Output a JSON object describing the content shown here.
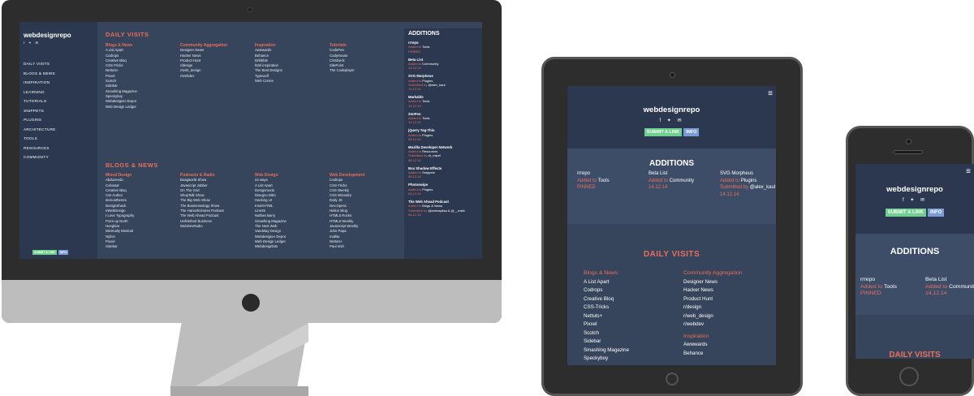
{
  "site": {
    "brand": "webdesignrepo",
    "social": "f  ✦  ✉",
    "submit_label": "SUBMIT A LINK",
    "info_label": "INFO"
  },
  "nav": [
    "DAILY VISITS",
    "BLOGS & NEWS",
    "INSPIRATION",
    "LEARNING",
    "TUTORIALS",
    "SNIPPETS",
    "PLUGINS",
    "ARCHITECTURE",
    "TOOLS",
    "RESOURCES",
    "COMMUNITY"
  ],
  "daily": {
    "title": "DAILY VISITS",
    "cols": [
      {
        "cat": "Blogs & News",
        "items": [
          "A List Apart",
          "Codrops",
          "Creative Bloq",
          "CSS-Tricks",
          "Nettuts+",
          "Pixxel",
          "Scotch",
          "Sidebar",
          "Smashing Magazine",
          "Speckyboy",
          "Webdesigner Depot",
          "Web Design Ledger"
        ]
      },
      {
        "cat": "Community Aggregation",
        "items": [
          "Designer News",
          "Hacker News",
          "Product Hunt",
          "r/design",
          "r/web_design",
          "r/webdev"
        ]
      },
      {
        "cat": "Inspiration",
        "items": [
          "Awwwards",
          "Behance",
          "Dribbble",
          "html inspiration",
          "The Best Designs",
          "Typewolf",
          "Web Creme"
        ]
      },
      {
        "cat": "Tutorials",
        "items": [
          "CodePen",
          "CodyHouse",
          "CSSDeck",
          "SitePoint",
          "The Codeplayer"
        ]
      }
    ]
  },
  "blogs": {
    "title": "BLOGS & NEWS",
    "cols": [
      {
        "cat": "Mixed Design",
        "items": [
          "Abduzeedo",
          "Colossal",
          "Creative Bloq",
          "Css Author",
          "demosthenes",
          "DesignShack",
          "eWebDesign",
          "I Love Typography",
          "From up North",
          "Hongkiat",
          "Minimally Minimal",
          "Nyllon",
          "Pixxel",
          "Sidebar"
        ]
      },
      {
        "cat": "Podcasts & Radio",
        "items": [
          "Boagworld Show",
          "Javascript Jabber",
          "On The Grid",
          "ShopTalk Show",
          "The Big Web Show",
          "The Businessology Show",
          "The Hanselminutes Podcast",
          "The Web Ahead Podcast",
          "Unfinished Business",
          "WebDevRadio"
        ]
      },
      {
        "cat": "Web Design",
        "items": [
          "24 ways",
          "A List Apart",
          "Designmodo",
          "Disegno Ditto",
          "Hacking UI",
          "InsertHTML",
          "Line25",
          "Nathan Barry",
          "Smashing Magazine",
          "The Next Web",
          "Vandelay Design",
          "Webdesigner Depot",
          "Web Design Ledger",
          "Webdesignbits"
        ]
      },
      {
        "cat": "Web Development",
        "items": [
          "Codrops",
          "CSS-Tricks",
          "CSS Weekly",
          "CSS Wizardry",
          "Daily JS",
          "Dev.Opera",
          "Helion Blog",
          "HTML5 Rocks",
          "HTML5 Weekly",
          "JavaScript Weekly",
          "John Papa",
          "mallitu",
          "Nettuts+",
          "Paul Irish"
        ]
      }
    ]
  },
  "additions": {
    "title": "ADDITIONS",
    "added_to": "Added to",
    "submitted_by": "Submitted by",
    "items": [
      {
        "name": "rrrepo",
        "cat": "Tools",
        "note": "PINNED"
      },
      {
        "name": "Beta List",
        "cat": "Community",
        "note": "14.12.14"
      },
      {
        "name": "SVG Morpheus",
        "cat": "Plugins",
        "by": "@alex_kaul",
        "note": "14.12.14"
      },
      {
        "name": "Markable",
        "cat": "Tools",
        "note": "14.12.14"
      },
      {
        "name": "ZenPen",
        "cat": "Tools",
        "note": "14.12.14"
      },
      {
        "name": "jQuery Tag-This",
        "cat": "Plugins",
        "note": "08.12.14"
      },
      {
        "name": "Mozilla Developer Network",
        "cat": "Resources",
        "by": "dr_mipel",
        "note": "08.12.14"
      },
      {
        "name": "Box Shadow Effects",
        "cat": "Snippets",
        "note": "08.12.14"
      },
      {
        "name": "Photoswipe",
        "cat": "Plugins",
        "note": "08.12.14"
      },
      {
        "name": "The Web Ahead Podcast",
        "cat": "Blogs & News",
        "by": "@aminapilsa & @__mstb",
        "note": "04.12.14"
      }
    ]
  },
  "tablet_daily": {
    "col1": {
      "cat": "Blogs & News",
      "items": [
        "A List Apart",
        "Codrops",
        "Creative Bloq",
        "CSS-Tricks",
        "Nettuts+",
        "Pixxel",
        "Scotch",
        "Sidebar",
        "Smashing Magazine",
        "Speckyboy"
      ]
    },
    "col2": {
      "cat": "Community Aggregation",
      "items": [
        "Designer News",
        "Hacker News",
        "Product Hunt",
        "r/design",
        "r/web_design",
        "r/webdev"
      ]
    },
    "col2b": {
      "cat": "Inspiration",
      "items": [
        "Awwwards",
        "Behance"
      ]
    }
  },
  "colors": {
    "bg": "#36445c",
    "sidebar": "#2c3850",
    "accent": "#e8705a",
    "submit": "#6fcf8f",
    "info": "#7a9bd6"
  }
}
